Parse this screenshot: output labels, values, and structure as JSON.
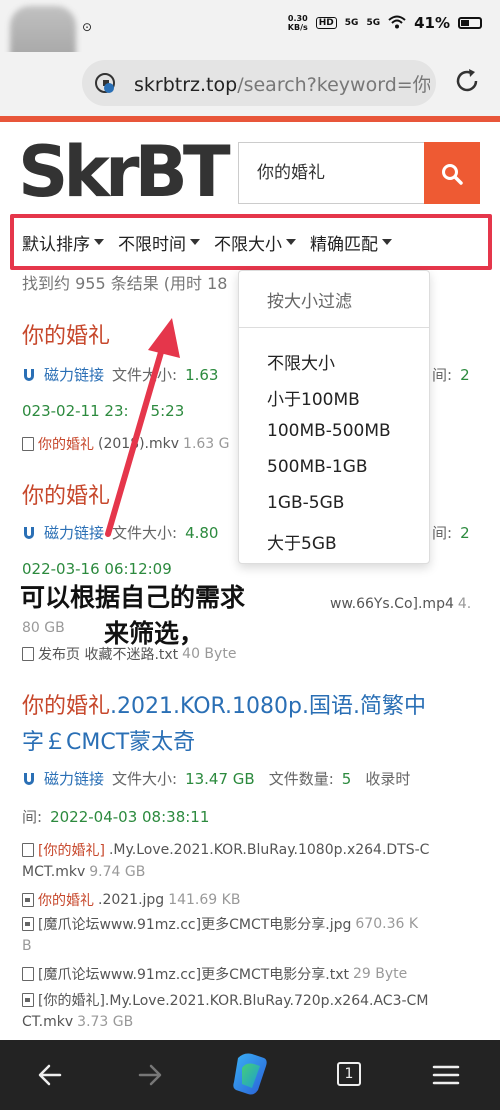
{
  "status_bar": {
    "speed_top": "0.30",
    "speed_bottom": "KB/s",
    "hd": "HD",
    "sig1": "5G",
    "sig2": "5G",
    "battery": "41%"
  },
  "browser": {
    "url_main": "skrbtrz.top",
    "url_rest": "/search?keyword=你的"
  },
  "site": {
    "logo": "SkrBT",
    "search_value": "你的婚礼",
    "accent": "#ee5a33"
  },
  "filters": [
    {
      "label": "默认排序"
    },
    {
      "label": "不限时间"
    },
    {
      "label": "不限大小"
    },
    {
      "label": "精确匹配"
    }
  ],
  "summary": "找到约 955 条结果 (用时 18",
  "size_dropdown": {
    "header": "按大小过滤",
    "options": [
      "不限大小",
      "小于100MB",
      "100MB-500MB",
      "500MB-1GB",
      "1GB-5GB",
      "大于5GB"
    ]
  },
  "results": [
    {
      "title": "你的婚礼",
      "magnet": "磁力链接",
      "size_label": "文件大小:",
      "size": "1.63",
      "count_tail": "间:",
      "count_val": "2",
      "date": "023-02-11 23:",
      "date_tail": "5:23",
      "file_red": "你的婚礼",
      "file_rest": " (2018).mkv",
      "file_size": "1.63 G"
    },
    {
      "title": "你的婚礼",
      "magnet": "磁力链接",
      "size_label": "文件大小:",
      "size": "4.80",
      "count_tail": "间:",
      "count_val": "2",
      "date": "022-03-16 06:12:09",
      "file_tail": "ww.66Ys.Co].mp4",
      "file_tail_size": "4.",
      "file_wrap": "80 GB",
      "file2_name": "发布页 收藏不迷路.txt",
      "file2_size": "40 Byte"
    },
    {
      "title_red": "你的婚礼",
      "title_blue": ".2021.KOR.1080p.国语.简繁中",
      "title_line2": "字￡CMCT蒙太奇",
      "magnet": "磁力链接",
      "size_label": "文件大小:",
      "size": "13.47 GB",
      "count_label": "文件数量:",
      "count": "5",
      "time_label": "收录时",
      "time_label2": "间:",
      "date": "2022-04-03 08:38:11",
      "files": [
        {
          "red": "[你的婚礼]",
          "rest": ".My.Love.2021.KOR.BluRay.1080p.x264.DTS-C",
          "rest2": "MCT.mkv",
          "size": "9.74 GB"
        },
        {
          "red": "你的婚礼",
          "rest": ".2021.jpg",
          "size": "141.69 KB"
        },
        {
          "rest": "[魔爪论坛www.91mz.cc]更多CMCT电影分享.jpg",
          "size": "670.36 K",
          "rest2": "B"
        },
        {
          "rest": "[魔爪论坛www.91mz.cc]更多CMCT电影分享.txt",
          "size": "29 Byte"
        },
        {
          "rest": "[你的婚礼].My.Love.2021.KOR.BluRay.720p.x264.AC3-CM",
          "rest2": "CT.mkv",
          "size": "3.73 GB"
        }
      ]
    }
  ],
  "annotation": {
    "line1": "可以根据自己的需求",
    "line2": "来筛选，"
  }
}
